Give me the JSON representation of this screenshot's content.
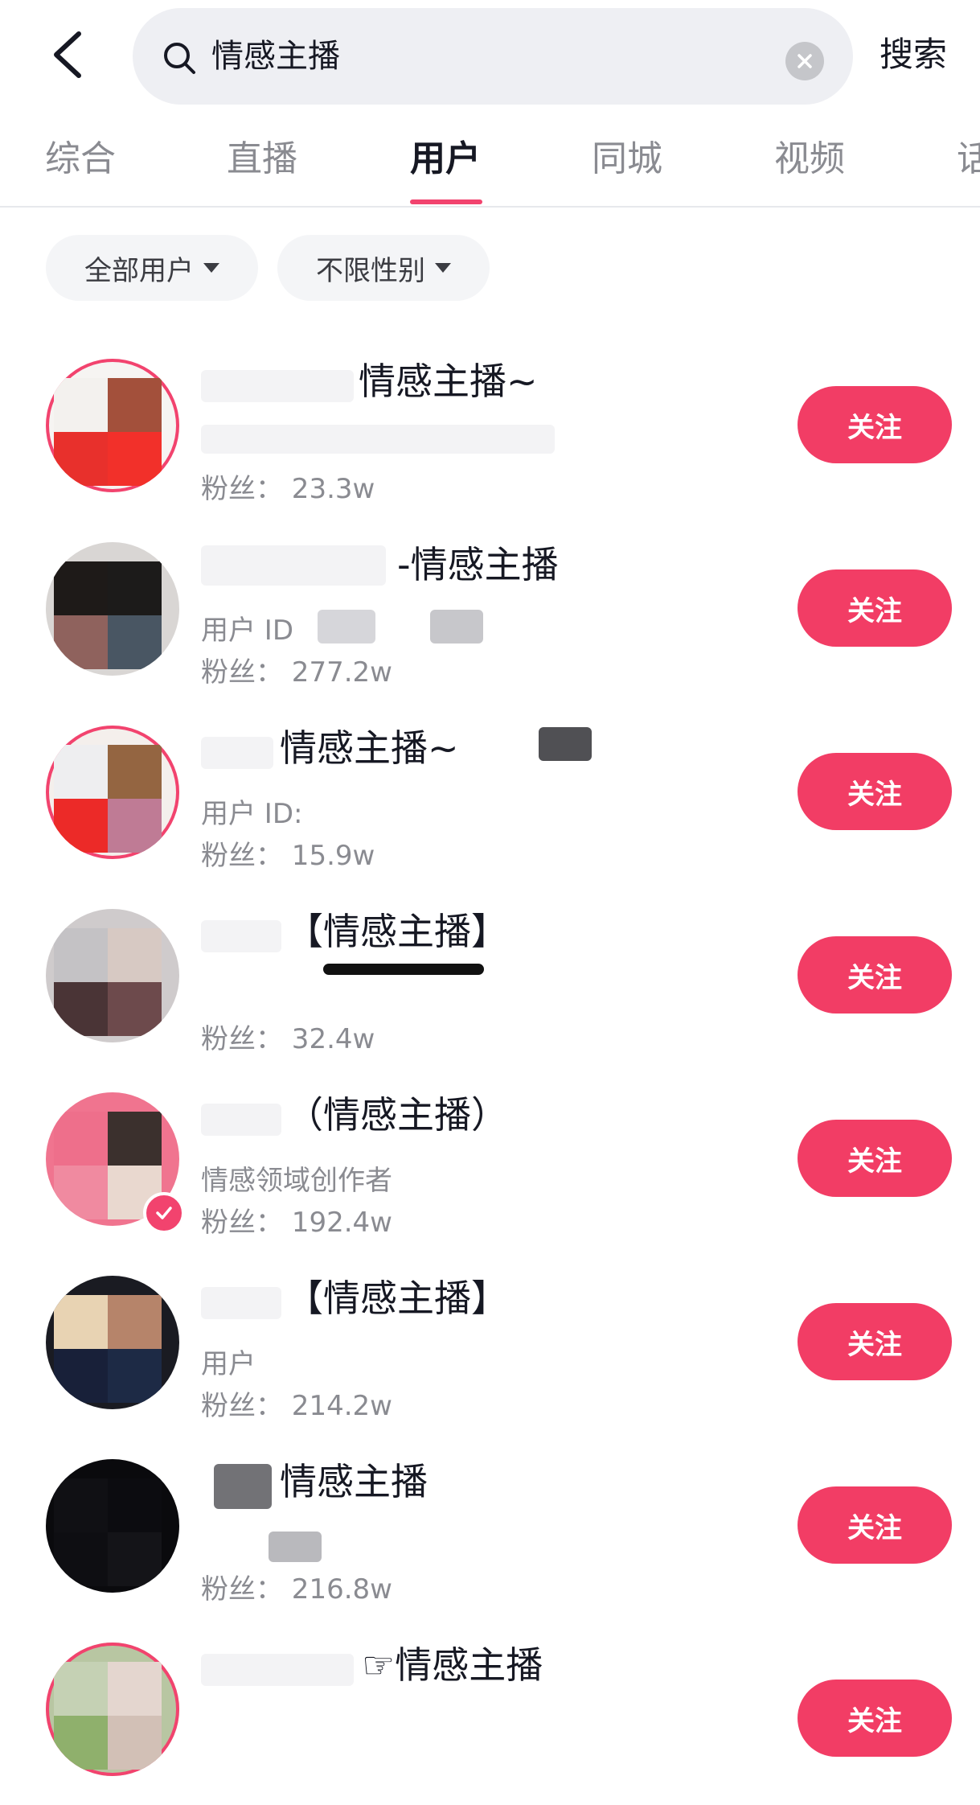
{
  "search": {
    "query": "情感主播",
    "submit_label": "搜索"
  },
  "tabs": [
    {
      "label": "综合",
      "active": false
    },
    {
      "label": "直播",
      "active": false
    },
    {
      "label": "用户",
      "active": true
    },
    {
      "label": "同城",
      "active": false
    },
    {
      "label": "视频",
      "active": false
    },
    {
      "label": "话",
      "active": false
    }
  ],
  "filters": {
    "user_type": "全部用户",
    "gender": "不限性别"
  },
  "users": [
    {
      "name": "情感主播~",
      "subtitle": "",
      "fans": "粉丝： 23.3w",
      "follow": "关注"
    },
    {
      "name": "-情感主播",
      "subtitle": "用户 ID",
      "fans": "粉丝： 277.2w",
      "follow": "关注"
    },
    {
      "name": "情感主播~",
      "subtitle": "用户 ID:",
      "fans": "粉丝： 15.9w",
      "follow": "关注"
    },
    {
      "name": "【情感主播】",
      "subtitle": "",
      "fans": "粉丝： 32.4w",
      "follow": "关注"
    },
    {
      "name": "（情感主播）",
      "subtitle": "情感领域创作者",
      "fans": "粉丝： 192.4w",
      "follow": "关注",
      "verified": true
    },
    {
      "name": "【情感主播】",
      "subtitle": "用户",
      "fans": "粉丝： 214.2w",
      "follow": "关注"
    },
    {
      "name": "情感主播",
      "subtitle": "",
      "fans": "粉丝： 216.8w",
      "follow": "关注"
    },
    {
      "name": "☞情感主播",
      "subtitle": "",
      "fans": "",
      "follow": "关注"
    }
  ],
  "colors": {
    "accent": "#f23d65",
    "text_primary": "#161823",
    "text_secondary": "#8a8b91",
    "search_bg": "#eeeff3"
  }
}
